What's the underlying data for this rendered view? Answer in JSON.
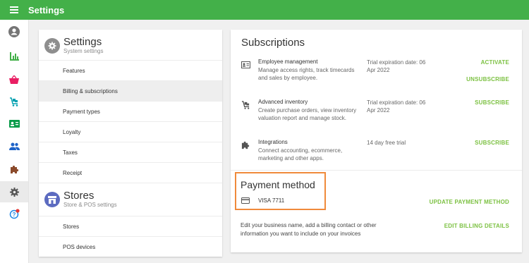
{
  "header": {
    "title": "Settings",
    "menu_icon": "menu-icon"
  },
  "sidebar": {
    "items": [
      {
        "name": "account",
        "icon": "account-icon",
        "color": "#757575"
      },
      {
        "name": "reports",
        "icon": "bar-chart-icon",
        "color": "#43b049"
      },
      {
        "name": "items",
        "icon": "basket-icon",
        "color": "#e91e63"
      },
      {
        "name": "inventory",
        "icon": "cart-icon",
        "color": "#00a0b0"
      },
      {
        "name": "employees",
        "icon": "id-card-icon",
        "color": "#0a9b4a"
      },
      {
        "name": "customers",
        "icon": "people-icon",
        "color": "#1e63c8"
      },
      {
        "name": "integrations",
        "icon": "puzzle-icon",
        "color": "#8b4a2b"
      },
      {
        "name": "settings",
        "icon": "gear-icon",
        "color": "#555555"
      },
      {
        "name": "help",
        "icon": "help-icon",
        "color": "#1e88e5"
      }
    ]
  },
  "settings_section": {
    "title": "Settings",
    "subtitle": "System settings",
    "items": [
      "Features",
      "Billing & subscriptions",
      "Payment types",
      "Loyalty",
      "Taxes",
      "Receipt"
    ],
    "active_index": 1
  },
  "stores_section": {
    "title": "Stores",
    "subtitle": "Store & POS settings",
    "items": [
      "Stores",
      "POS devices"
    ]
  },
  "subscriptions": {
    "title": "Subscriptions",
    "rows": [
      {
        "name": "Employee management",
        "description": "Manage access rights, track timecards and sales by employee.",
        "status": "Trial expiration date: 06 Apr 2022",
        "actions": [
          "ACTIVATE",
          "UNSUBSCRIBE"
        ]
      },
      {
        "name": "Advanced inventory",
        "description": "Create purchase orders, view inventory valuation report and manage stock.",
        "status": "Trial expiration date: 06 Apr 2022",
        "actions": [
          "SUBSCRIBE"
        ]
      },
      {
        "name": "Integrations",
        "description": "Connect accounting, ecommerce, marketing and other apps.",
        "status": "14 day free trial",
        "actions": [
          "SUBSCRIBE"
        ]
      }
    ]
  },
  "payment_method": {
    "title": "Payment method",
    "card": "VISA 7711",
    "update_label": "UPDATE PAYMENT METHOD"
  },
  "billing": {
    "description": "Edit your business name, add a billing contact or other information you want to include on your invoices",
    "edit_label": "EDIT BILLING DETAILS"
  },
  "colors": {
    "brand": "#43b049",
    "action": "#7cc142",
    "highlight": "#f08a3b"
  }
}
